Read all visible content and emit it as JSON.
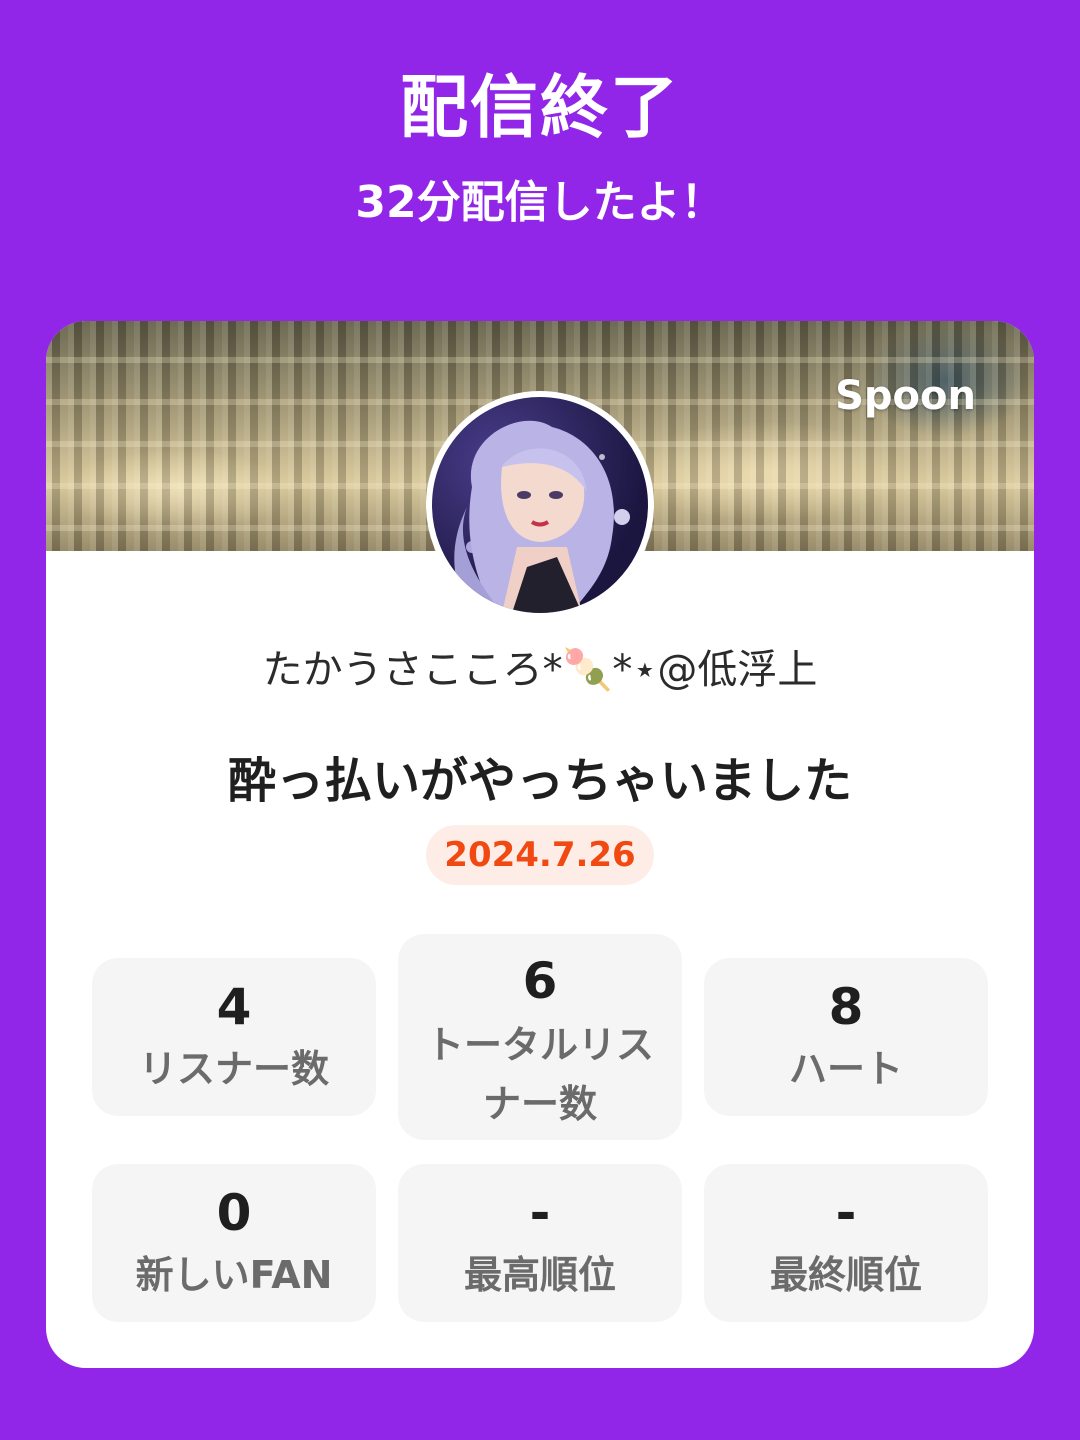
{
  "header": {
    "title": "配信終了",
    "subtitle": "32分配信したよ！"
  },
  "card": {
    "brand": "Spoon",
    "host_name": "たかうさこころ*🍡*⋆@低浮上",
    "broadcast_title": "酔っ払いがやっちゃいました",
    "date": "2024.7.26",
    "stats": [
      {
        "value": "4",
        "label": "リスナー数"
      },
      {
        "value": "6",
        "label": "トータルリス",
        "label2": "ナー数"
      },
      {
        "value": "8",
        "label": "ハート"
      },
      {
        "value": "0",
        "label": "新しいFAN"
      },
      {
        "value": "-",
        "label": "最高順位"
      },
      {
        "value": "-",
        "label": "最終順位"
      }
    ]
  },
  "colors": {
    "background": "#9226E8",
    "date_text": "#F04A12",
    "date_bg": "#FEEDE7",
    "stat_bg": "#F5F5F5"
  }
}
